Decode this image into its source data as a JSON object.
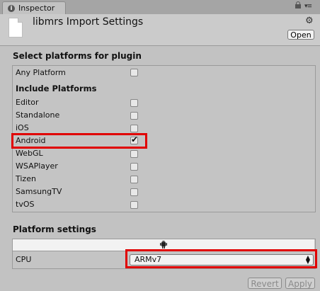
{
  "window": {
    "tab_label": "Inspector",
    "title": "libmrs Import Settings",
    "open_label": "Open"
  },
  "platforms": {
    "section_title": "Select platforms for plugin",
    "any_platform": {
      "label": "Any Platform",
      "checked": false
    },
    "include_title": "Include Platforms",
    "items": [
      {
        "label": "Editor",
        "checked": false
      },
      {
        "label": "Standalone",
        "checked": false
      },
      {
        "label": "iOS",
        "checked": false
      },
      {
        "label": "Android",
        "checked": true
      },
      {
        "label": "WebGL",
        "checked": false
      },
      {
        "label": "WSAPlayer",
        "checked": false
      },
      {
        "label": "Tizen",
        "checked": false
      },
      {
        "label": "SamsungTV",
        "checked": false
      },
      {
        "label": "tvOS",
        "checked": false
      }
    ]
  },
  "platform_settings": {
    "section_title": "Platform settings",
    "selected_tab_icon": "android-icon",
    "cpu_label": "CPU",
    "cpu_value": "ARMv7"
  },
  "footer": {
    "revert_label": "Revert",
    "apply_label": "Apply"
  },
  "colors": {
    "highlight": "#e00000",
    "background": "#c2c2c2"
  }
}
